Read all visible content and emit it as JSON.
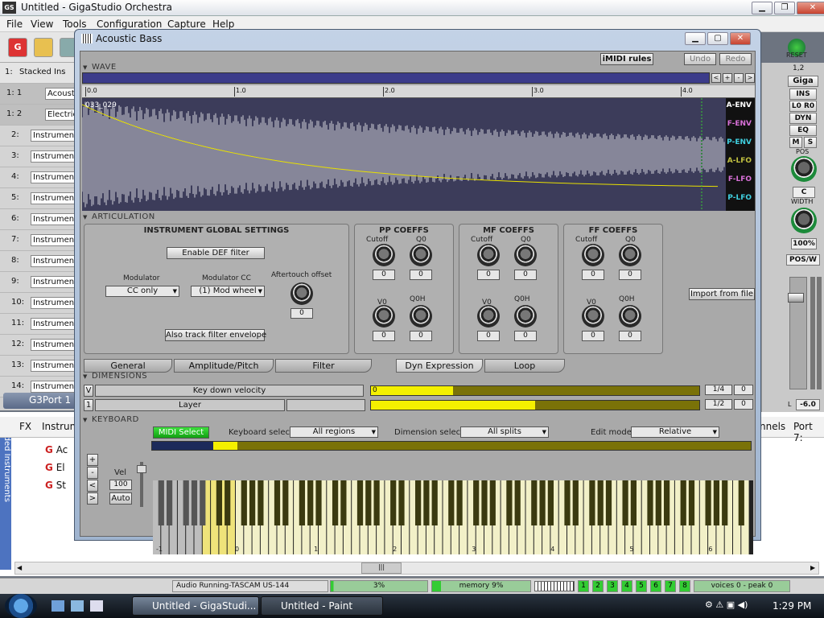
{
  "main_window": {
    "title": "Untitled - GigaStudio Orchestra",
    "menu": [
      "File",
      "View",
      "Tools",
      "Configuration",
      "Capture",
      "Help"
    ]
  },
  "left_list": {
    "header_num": "1:",
    "header_label": "Stacked Ins",
    "rows": [
      {
        "num": "1:  1",
        "label": "Acoust"
      },
      {
        "num": "1:  2",
        "label": "Electric"
      },
      {
        "num": "2:",
        "label": "Instruments"
      },
      {
        "num": "3:",
        "label": "Instruments"
      },
      {
        "num": "4:",
        "label": "Instruments"
      },
      {
        "num": "5:",
        "label": "Instruments"
      },
      {
        "num": "6:",
        "label": "Instruments"
      },
      {
        "num": "7:",
        "label": "Instruments"
      },
      {
        "num": "8:",
        "label": "Instruments"
      },
      {
        "num": "9:",
        "label": "Instruments"
      },
      {
        "num": "10:",
        "label": "Instruments"
      },
      {
        "num": "11:",
        "label": "Instruments"
      },
      {
        "num": "12:",
        "label": "Instruments"
      },
      {
        "num": "13:",
        "label": "Instruments"
      },
      {
        "num": "14:",
        "label": "Instruments"
      }
    ],
    "port": "G3Port 1"
  },
  "right_strip": {
    "reset": "RESET",
    "channel": "1,2",
    "giga": "Giga",
    "ins": "INS",
    "lr": "L0 R0",
    "dyn": "DYN",
    "eq": "EQ",
    "m": "M",
    "s": "S",
    "pos": "POS",
    "pos_val": "C",
    "width": "WIDTH",
    "width_val": "100%",
    "possw": "POS/W",
    "db": "-6.0",
    "l": "L"
  },
  "editor": {
    "title": "Acoustic Bass",
    "wave": {
      "section": "WAVE",
      "imidi": "iMIDI rules",
      "undo": "Undo",
      "redo": "Redo",
      "ruler": [
        "0.0",
        "1.0",
        "2.0",
        "3.0",
        "4.0"
      ],
      "sample_name": "033_029",
      "envelopes": [
        {
          "label": "A-ENV",
          "color": "#ffffff"
        },
        {
          "label": "F-ENV",
          "color": "#d870d8"
        },
        {
          "label": "P-ENV",
          "color": "#40d0e0"
        },
        {
          "label": "A-LFO",
          "color": "#c0c040"
        },
        {
          "label": "F-LFO",
          "color": "#d870d8"
        },
        {
          "label": "P-LFO",
          "color": "#40d0e0"
        }
      ],
      "nav": [
        "<",
        "+",
        "-",
        ">"
      ]
    },
    "articulation": {
      "section": "ARTICULATION",
      "global_title": "INSTRUMENT GLOBAL SETTINGS",
      "enable_def": "Enable DEF filter",
      "modulator_label": "Modulator",
      "modulator_value": "CC only",
      "modulator_cc_label": "Modulator CC",
      "modulator_cc_value": "(1) Mod wheel",
      "aftertouch_label": "Aftertouch offset",
      "aftertouch_value": "0",
      "track_env": "Also track filter envelope",
      "import": "Import from file",
      "coeff_groups": [
        {
          "title": "PP COEFFS",
          "cutoff": "Cutoff",
          "q0": "Q0",
          "v0": "V0",
          "q0h": "Q0H",
          "values": [
            "0",
            "0",
            "0",
            "0"
          ]
        },
        {
          "title": "MF COEFFS",
          "cutoff": "Cutoff",
          "q0": "Q0",
          "v0": "V0",
          "q0h": "Q0H",
          "values": [
            "0",
            "0",
            "0",
            "0"
          ]
        },
        {
          "title": "FF COEFFS",
          "cutoff": "Cutoff",
          "q0": "Q0",
          "v0": "V0",
          "q0h": "Q0H",
          "values": [
            "0",
            "0",
            "0",
            "0"
          ]
        }
      ],
      "tabs": [
        "General",
        "Amplitude/Pitch",
        "Filter",
        "Dyn Expression",
        "Loop"
      ],
      "active_tab": "Dyn Expression"
    },
    "dimensions": {
      "section": "DIMENSIONS",
      "rows": [
        {
          "key": "V",
          "name": "Key down velocity",
          "start": "0",
          "fraction": "1/4",
          "value": "0",
          "fill": 0.25
        },
        {
          "key": "1",
          "name": "Layer",
          "start": "",
          "fraction": "1/2",
          "value": "0",
          "fill": 0.5
        }
      ]
    },
    "keyboard": {
      "section": "KEYBOARD",
      "midi_select": "MIDI Select",
      "keyboard_select_label": "Keyboard select",
      "keyboard_select_value": "All regions",
      "dimension_select_label": "Dimension select",
      "dimension_select_value": "All splits",
      "edit_mode_label": "Edit mode",
      "edit_mode_value": "Relative",
      "plus": "+",
      "minus": "-",
      "left": "<",
      "right": ">",
      "vel_label": "Vel",
      "vel_value": "100",
      "auto": "Auto",
      "octaves": [
        "-1",
        "0",
        "1",
        "2",
        "3",
        "4",
        "5",
        "6"
      ]
    }
  },
  "bottom": {
    "tabs": [
      "FX",
      "Instrum"
    ],
    "right_tabs": [
      "nnels",
      "Port 7:"
    ],
    "loaded_label": "Loaded Instruments",
    "items": [
      "Ac",
      "El",
      "St"
    ]
  },
  "status": {
    "audio": "Audio Running-TASCAM US-144",
    "cpu": "3%",
    "memory": "memory 9%",
    "channels": [
      "1",
      "2",
      "3",
      "4",
      "5",
      "6",
      "7",
      "8"
    ],
    "voices": "voices 0 - peak 0"
  },
  "taskbar": {
    "tasks": [
      "Untitled - GigaStudi...",
      "Untitled - Paint"
    ],
    "clock": "1:29 PM"
  },
  "colors": {
    "accent_green": "#1c9a3a",
    "dim_yellow": "#f4f000",
    "wave_bg": "#3c3c5a"
  }
}
